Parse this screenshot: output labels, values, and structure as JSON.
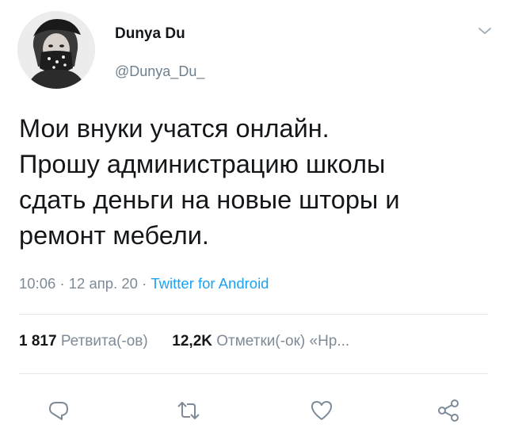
{
  "author": {
    "display_name": "Dunya Du",
    "handle": "@Dunya_Du_"
  },
  "tweet": {
    "lines": [
      "Мои внуки учатся онлайн.",
      "Прошу администрацию школы",
      "сдать деньги на новые шторы и",
      "ремонт мебели."
    ],
    "time": "10:06",
    "date": "12 апр. 20",
    "separator": "·",
    "source": "Twitter for Android"
  },
  "stats": {
    "retweets_count": "1 817",
    "retweets_label": "Ретвита(-ов)",
    "likes_count": "12,2K",
    "likes_label": "Отметки(-ок) «Нр..."
  },
  "icons": {
    "menu": "chevron-down-icon",
    "reply": "reply-icon",
    "retweet": "retweet-icon",
    "like": "heart-icon",
    "share": "share-icon"
  },
  "colors": {
    "text": "#14171a",
    "secondary": "#7e8b97",
    "link": "#1da1f2",
    "divider": "#e1e8ed"
  }
}
